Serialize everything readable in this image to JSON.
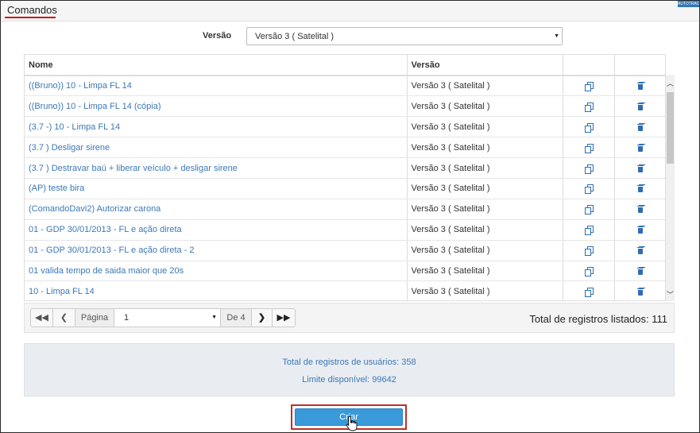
{
  "header": {
    "title": "Comandos",
    "badge": "AUTOTRAC"
  },
  "filter": {
    "label": "Versão",
    "selected": "Versão 3 ( Satelital )"
  },
  "table": {
    "columns": [
      "Nome",
      "Versão",
      "",
      ""
    ],
    "rows": [
      {
        "name": "((Bruno)) 10 - Limpa FL 14",
        "version": "Versão 3 ( Satelital )"
      },
      {
        "name": "((Bruno)) 10 - Limpa FL 14 (cópia)",
        "version": "Versão 3 ( Satelital )"
      },
      {
        "name": "(3.7 -) 10 - Limpa FL 14",
        "version": "Versão 3 ( Satelital )"
      },
      {
        "name": "(3.7 ) Desligar sirene",
        "version": "Versão 3 ( Satelital )"
      },
      {
        "name": "(3.7 ) Destravar baú + liberar veículo + desligar sirene",
        "version": "Versão 3 ( Satelital )"
      },
      {
        "name": "(AP) teste bira",
        "version": "Versão 3 ( Satelital )"
      },
      {
        "name": "(ComandoDavi2) Autorizar carona",
        "version": "Versão 3 ( Satelital )"
      },
      {
        "name": "01 - GDP 30/01/2013 - FL e ação direta",
        "version": "Versão 3 ( Satelital )"
      },
      {
        "name": "01 - GDP 30/01/2013 - FL e ação direta - 2",
        "version": "Versão 3 ( Satelital )"
      },
      {
        "name": "01 valida tempo de saida maior que 20s",
        "version": "Versão 3 ( Satelital )"
      },
      {
        "name": "10 - Limpa FL 14",
        "version": "Versão 3 ( Satelital )"
      },
      {
        "name": "",
        "version": ""
      }
    ],
    "row_icons": {
      "copy": "copy-icon",
      "delete": "trash-icon"
    }
  },
  "pager": {
    "page_label": "Página",
    "current_page": "1",
    "of_label": "De 4",
    "total_listed": "Total de registros listados: 111",
    "icons": {
      "first": "double-chevron-left-icon",
      "prev": "chevron-left-icon",
      "next": "chevron-right-icon",
      "last": "double-chevron-right-icon"
    }
  },
  "info": {
    "users_total": "Total de registros de usuários: 358",
    "limit": "Limite disponível: 99642"
  },
  "actions": {
    "create_label": "Criar"
  },
  "colors": {
    "link": "#3c78b6",
    "primary_button": "#3a9ad9",
    "highlight": "#c0302a",
    "title_underline": "#d01818"
  }
}
